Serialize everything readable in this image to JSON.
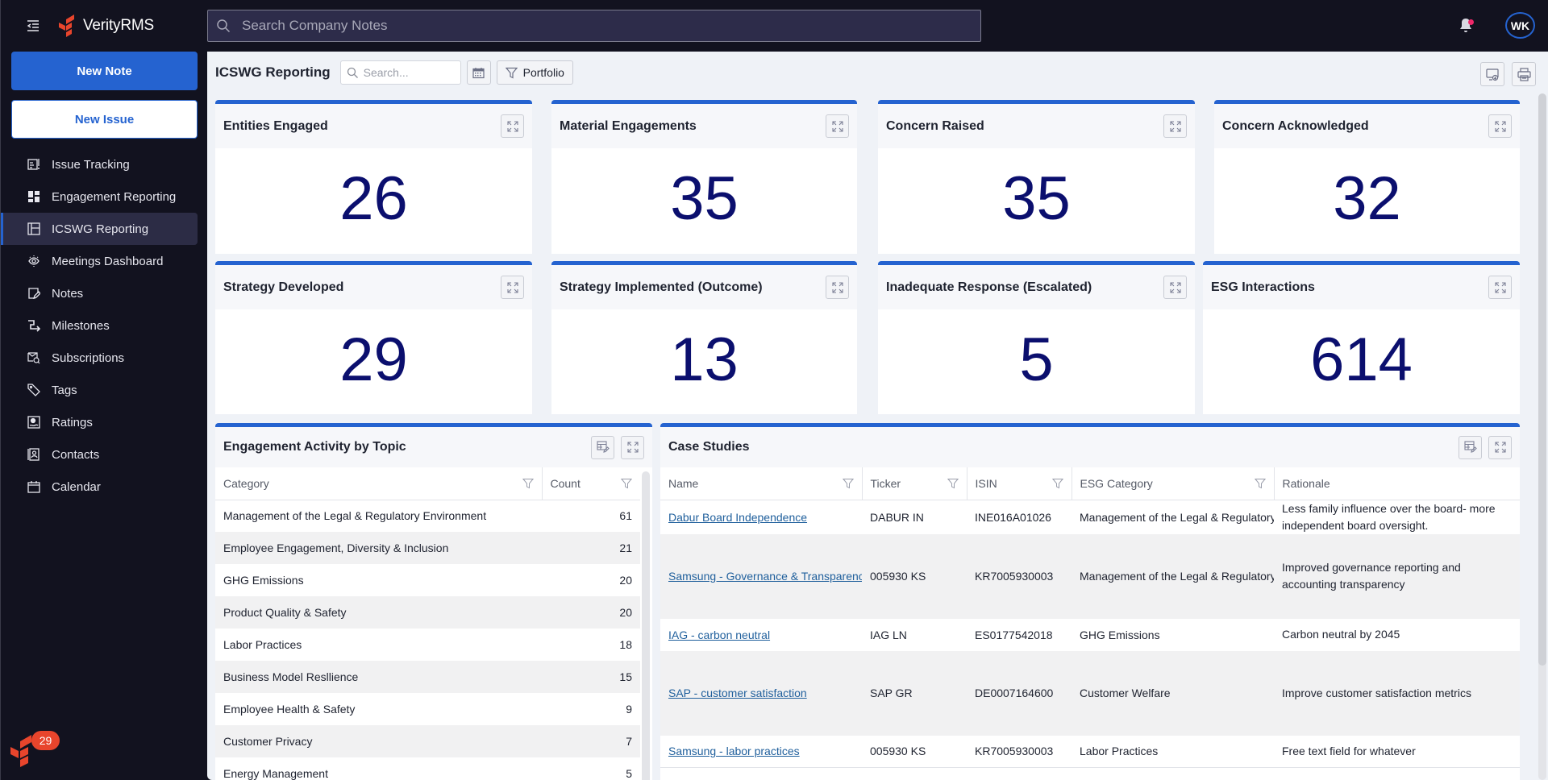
{
  "app": {
    "brand": "VerityRMS",
    "notification_badge": "29"
  },
  "sidebar": {
    "new_note": "New Note",
    "new_issue": "New Issue",
    "items": [
      {
        "label": "Issue Tracking",
        "icon": "issue-tracking-icon"
      },
      {
        "label": "Engagement Reporting",
        "icon": "dashboard-icon"
      },
      {
        "label": "ICSWG Reporting",
        "icon": "layout-icon",
        "active": true
      },
      {
        "label": "Meetings Dashboard",
        "icon": "eye-icon"
      },
      {
        "label": "Notes",
        "icon": "note-edit-icon"
      },
      {
        "label": "Milestones",
        "icon": "milestone-icon"
      },
      {
        "label": "Subscriptions",
        "icon": "subscriptions-icon"
      },
      {
        "label": "Tags",
        "icon": "tag-icon"
      },
      {
        "label": "Ratings",
        "icon": "ratings-icon"
      },
      {
        "label": "Contacts",
        "icon": "contacts-icon"
      },
      {
        "label": "Calendar",
        "icon": "calendar-icon"
      }
    ]
  },
  "topbar": {
    "search_placeholder": "Search Company Notes",
    "user_initials": "WK"
  },
  "page": {
    "title": "ICSWG Reporting",
    "search_placeholder": "Search...",
    "filter_label": "Portfolio"
  },
  "kpis": [
    {
      "title": "Entities Engaged",
      "value": "26"
    },
    {
      "title": "Material Engagements",
      "value": "35"
    },
    {
      "title": "Concern Raised",
      "value": "35"
    },
    {
      "title": "Concern Acknowledged",
      "value": "32"
    },
    {
      "title": "Strategy Developed",
      "value": "29"
    },
    {
      "title": "Strategy Implemented (Outcome)",
      "value": "13"
    },
    {
      "title": "Inadequate Response (Escalated)",
      "value": "5"
    },
    {
      "title": "ESG Interactions",
      "value": "614"
    }
  ],
  "topics": {
    "title": "Engagement Activity by Topic",
    "columns": [
      "Category",
      "Count"
    ],
    "rows": [
      {
        "category": "Management of the Legal & Regulatory Environment",
        "count": "61"
      },
      {
        "category": "Employee Engagement, Diversity & Inclusion",
        "count": "21"
      },
      {
        "category": "GHG Emissions",
        "count": "20"
      },
      {
        "category": "Product Quality & Safety",
        "count": "20"
      },
      {
        "category": "Labor Practices",
        "count": "18"
      },
      {
        "category": "Business Model Resllience",
        "count": "15"
      },
      {
        "category": "Employee Health & Safety",
        "count": "9"
      },
      {
        "category": "Customer Privacy",
        "count": "7"
      },
      {
        "category": "Energy Management",
        "count": "5"
      }
    ]
  },
  "case_studies": {
    "title": "Case Studies",
    "columns": [
      "Name",
      "Ticker",
      "ISIN",
      "ESG Category",
      "Rationale"
    ],
    "rows": [
      {
        "name": "Dabur Board Independence",
        "ticker": "DABUR IN",
        "isin": "INE016A01026",
        "category": "Management of the Legal & Regulatory Environment",
        "rationale": "Less family influence over the board- more independent board oversight."
      },
      {
        "name": "Samsung - Governance & Transparency",
        "ticker": "005930 KS",
        "isin": "KR7005930003",
        "category": "Management of the Legal & Regulatory Environment",
        "rationale": "Improved governance reporting and accounting transparency"
      },
      {
        "name": "IAG - carbon neutral",
        "ticker": "IAG LN",
        "isin": "ES0177542018",
        "category": "GHG Emissions",
        "rationale": "Carbon neutral by 2045"
      },
      {
        "name": "SAP - customer satisfaction",
        "ticker": "SAP GR",
        "isin": "DE0007164600",
        "category": "Customer Welfare",
        "rationale": "Improve customer satisfaction metrics"
      },
      {
        "name": "Samsung - labor practices",
        "ticker": "005930 KS",
        "isin": "KR7005930003",
        "category": "Labor Practices",
        "rationale": "Free text field for whatever"
      }
    ]
  }
}
